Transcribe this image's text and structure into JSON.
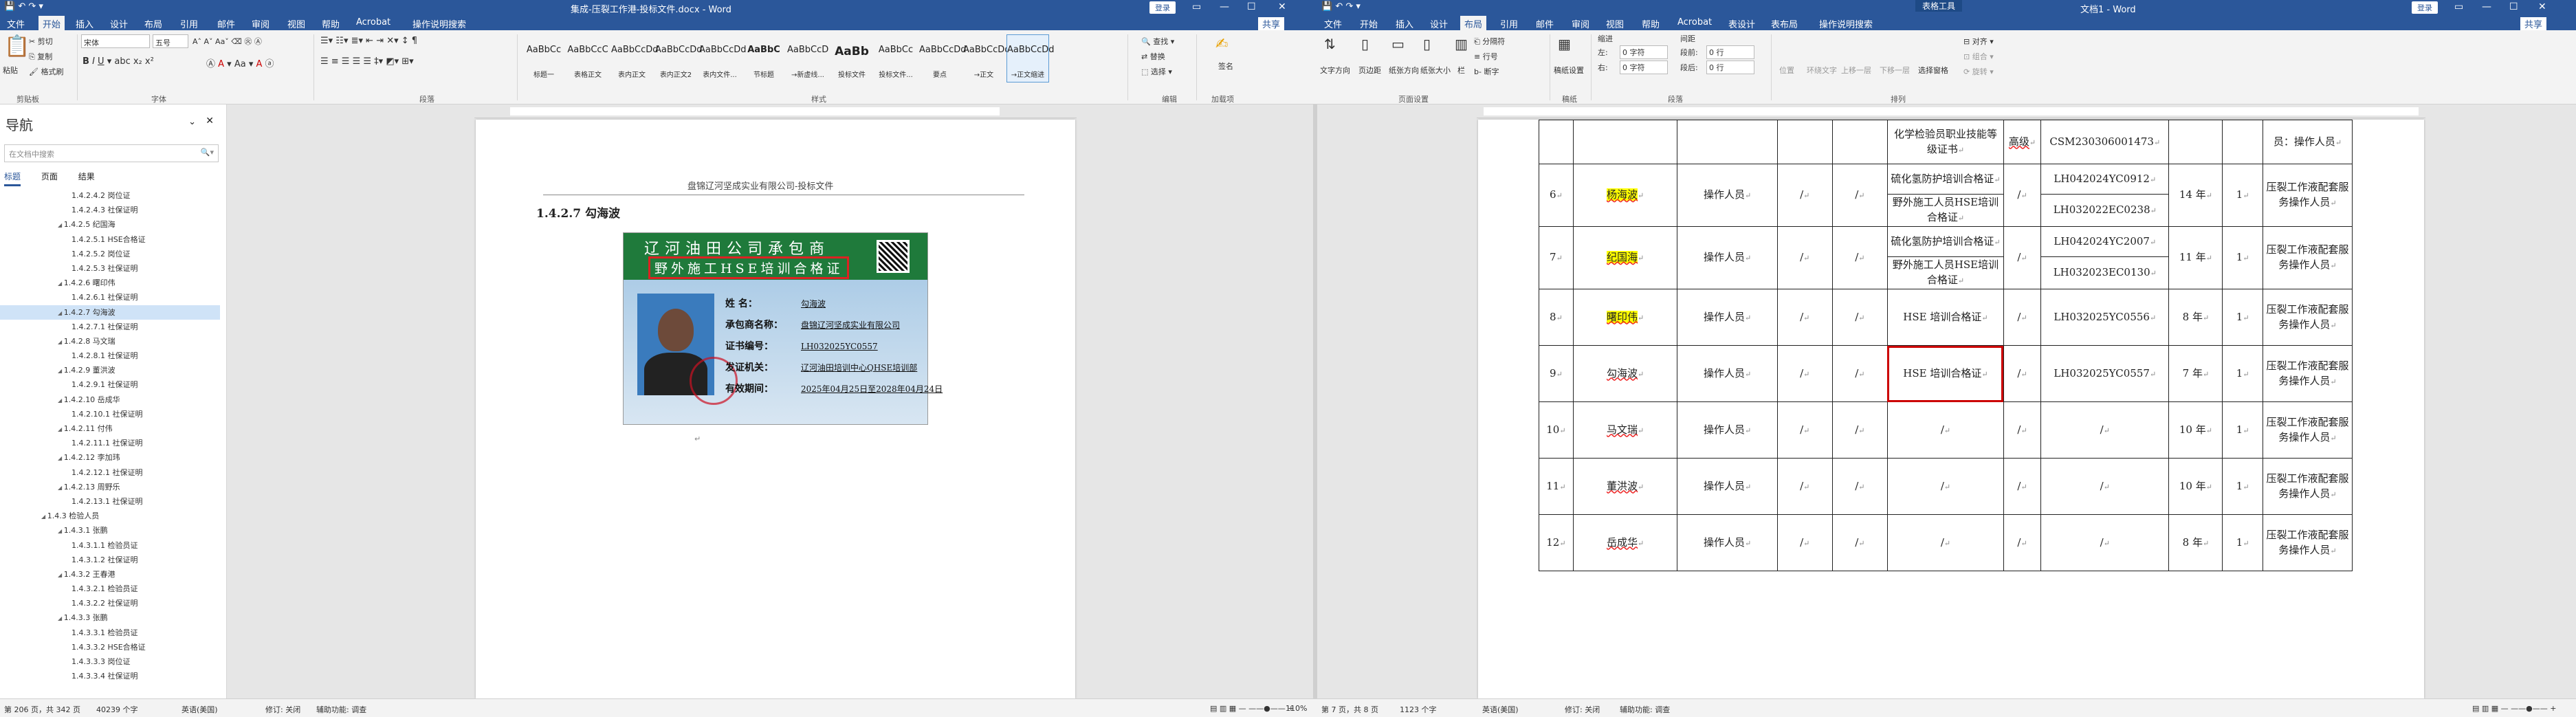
{
  "left": {
    "title": "集成-压裂工作港-投标文件.docx - Word",
    "login": "登录",
    "tabs": [
      "文件",
      "开始",
      "插入",
      "设计",
      "布局",
      "引用",
      "邮件",
      "审阅",
      "视图",
      "帮助",
      "Acrobat",
      "操作说明搜索"
    ],
    "active_tab": "开始",
    "share": "共享",
    "clipboard": {
      "paste": "粘贴",
      "cut": "剪切",
      "copy": "复制",
      "painter": "格式刷",
      "label": "剪贴板"
    },
    "font": {
      "name": "宋体",
      "size": "五号",
      "label": "字体"
    },
    "paragraph_label": "段落",
    "styles": [
      {
        "preview": "AaBbCc",
        "name": "标题一"
      },
      {
        "preview": "AaBbCcC",
        "name": "表格正文"
      },
      {
        "preview": "AaBbCcDd",
        "name": "表内正文"
      },
      {
        "preview": "AaBbCcDd",
        "name": "表内正文2"
      },
      {
        "preview": "AaBbCcDd",
        "name": "表内文件..."
      },
      {
        "preview": "AaBbC",
        "name": "节标题"
      },
      {
        "preview": "AaBbCcD",
        "name": "→新虚线..."
      },
      {
        "preview": "AaBb",
        "name": "投标文件"
      },
      {
        "preview": "AaBbCc",
        "name": "投标文件..."
      },
      {
        "preview": "AaBbCcDd",
        "name": "要点"
      },
      {
        "preview": "AaBbCcDd",
        "name": "→正文"
      },
      {
        "preview": "AaBbCcDd",
        "name": "→正文缩进"
      }
    ],
    "styles_label": "样式",
    "editing": {
      "find": "查找",
      "replace": "替换",
      "select": "选择",
      "label": "编辑"
    },
    "signature": {
      "label": "加载项",
      "btn": "签名"
    },
    "nav": {
      "title": "导航",
      "search_placeholder": "在文档中搜索",
      "tabs": [
        "标题",
        "页面",
        "结果"
      ],
      "items": [
        {
          "text": "1.4.2.4.2 岗位证",
          "level": 4
        },
        {
          "text": "1.4.2.4.3 社保证明",
          "level": 4
        },
        {
          "text": "1.4.2.5 纪国海",
          "level": 3
        },
        {
          "text": "1.4.2.5.1 HSE合格证",
          "level": 4
        },
        {
          "text": "1.4.2.5.2 岗位证",
          "level": 4
        },
        {
          "text": "1.4.2.5.3 社保证明",
          "level": 4
        },
        {
          "text": "1.4.2.6 曙印伟",
          "level": 3
        },
        {
          "text": "1.4.2.6.1 社保证明",
          "level": 4
        },
        {
          "text": "1.4.2.7 勾海波",
          "level": 3,
          "selected": true
        },
        {
          "text": "1.4.2.7.1 社保证明",
          "level": 4
        },
        {
          "text": "1.4.2.8 马文瑞",
          "level": 3
        },
        {
          "text": "1.4.2.8.1 社保证明",
          "level": 4
        },
        {
          "text": "1.4.2.9 董洪波",
          "level": 3
        },
        {
          "text": "1.4.2.9.1 社保证明",
          "level": 4
        },
        {
          "text": "1.4.2.10 岳成华",
          "level": 3
        },
        {
          "text": "1.4.2.10.1 社保证明",
          "level": 4
        },
        {
          "text": "1.4.2.11 付伟",
          "level": 3
        },
        {
          "text": "1.4.2.11.1 社保证明",
          "level": 4
        },
        {
          "text": "1.4.2.12 李加玮",
          "level": 3
        },
        {
          "text": "1.4.2.12.1 社保证明",
          "level": 4
        },
        {
          "text": "1.4.2.13 周野乐",
          "level": 3
        },
        {
          "text": "1.4.2.13.1 社保证明",
          "level": 4
        },
        {
          "text": "1.4.3 检验人员",
          "level": 2
        },
        {
          "text": "1.4.3.1 张鹏",
          "level": 3
        },
        {
          "text": "1.4.3.1.1 检验员证",
          "level": 4
        },
        {
          "text": "1.4.3.1.2 社保证明",
          "level": 4
        },
        {
          "text": "1.4.3.2 王春港",
          "level": 3
        },
        {
          "text": "1.4.3.2.1 检验员证",
          "level": 4
        },
        {
          "text": "1.4.3.2.2 社保证明",
          "level": 4
        },
        {
          "text": "1.4.3.3 张鹏",
          "level": 3
        },
        {
          "text": "1.4.3.3.1 检验员证",
          "level": 4
        },
        {
          "text": "1.4.3.3.2 HSE合格证",
          "level": 4
        },
        {
          "text": "1.4.3.3.3 岗位证",
          "level": 4
        },
        {
          "text": "1.4.3.3.4 社保证明",
          "level": 4
        }
      ]
    },
    "page": {
      "header": "盘锦辽河坚成实业有限公司-投标文件",
      "heading": "1.4.2.7 勾海波",
      "cert": {
        "line1": "辽河油田公司承包商",
        "line2": "野外施工HSE培训合格证",
        "fields": [
          {
            "k": "姓      名：",
            "v": "勾海波"
          },
          {
            "k": "承包商名称：",
            "v": "盘锦辽河坚成实业有限公司"
          },
          {
            "k": "证书编号：",
            "v": "LH032025YC0557"
          },
          {
            "k": "发证机关：",
            "v": "辽河油田培训中心QHSE培训部"
          },
          {
            "k": "有效期间：",
            "v": "2025年04月25日至2028年04月24日"
          }
        ]
      }
    },
    "status": {
      "page": "第 206 页，共 342 页",
      "words": "40239 个字",
      "lang": "英语(美国)",
      "track": "修订: 关闭",
      "access": "辅助功能: 调查",
      "zoom": "110%"
    }
  },
  "right": {
    "title": "文档1 - Word",
    "context_tools": "表格工具",
    "login": "登录",
    "share": "共享",
    "tabs": [
      "文件",
      "开始",
      "插入",
      "设计",
      "布局",
      "引用",
      "邮件",
      "审阅",
      "视图",
      "帮助",
      "Acrobat",
      "表设计",
      "表布局",
      "操作说明搜索"
    ],
    "active_tab": "布局",
    "ribbon": {
      "text_dir": "文字方向",
      "margins": "页边距",
      "orientation": "纸张方向",
      "size": "纸张大小",
      "columns": "栏",
      "breaks": "分隔符",
      "linenum": "行号",
      "hyphen": "断字",
      "page_setup": "页面设置",
      "draft": "稿纸设置",
      "draft_group": "稿纸",
      "indent": "缩进",
      "left": "左:",
      "right": "右:",
      "indent_l": "0 字符",
      "indent_r": "0 字符",
      "spacing": "间距",
      "before": "段前:",
      "after": "段后:",
      "sp_b": "0 行",
      "sp_a": "0 行",
      "para": "段落",
      "position": "位置",
      "wrap": "环绕文字",
      "forward": "上移一层",
      "backward": "下移一层",
      "pane": "选择窗格",
      "align": "对齐",
      "group": "组合",
      "rotate": "旋转",
      "arrange": "排列"
    },
    "table": {
      "top_row": [
        "化学检验员职业技能等级证书",
        "高级",
        "CSM230306001473",
        "员：操作人员"
      ],
      "rows": [
        {
          "no": "6",
          "name": "杨海波",
          "role": "操作人员",
          "c1": "/",
          "c2": "/",
          "certs": [
            "硫化氢防护培训合格证",
            "野外施工人员HSE培训合格证"
          ],
          "c3": "/",
          "ids": [
            "LH042024YC0912",
            "LH032022EC0238"
          ],
          "years": "14 年",
          "n": "1",
          "duty": "压裂工作液配套服务操作人员",
          "hl": true
        },
        {
          "no": "7",
          "name": "纪国海",
          "role": "操作人员",
          "c1": "/",
          "c2": "/",
          "certs": [
            "硫化氢防护培训合格证",
            "野外施工人员HSE培训合格证"
          ],
          "c3": "/",
          "ids": [
            "LH042024YC2007",
            "LH032023EC0130"
          ],
          "years": "11 年",
          "n": "1",
          "duty": "压裂工作液配套服务操作人员",
          "hl": true
        },
        {
          "no": "8",
          "name": "曙印伟",
          "role": "操作人员",
          "c1": "/",
          "c2": "/",
          "certs": [
            "HSE 培训合格证"
          ],
          "c3": "/",
          "ids": [
            "LH032025YC0556"
          ],
          "years": "8 年",
          "n": "1",
          "duty": "压裂工作液配套服务操作人员",
          "hl": true
        },
        {
          "no": "9",
          "name": "勾海波",
          "role": "操作人员",
          "c1": "/",
          "c2": "/",
          "certs": [
            "HSE 培训合格证"
          ],
          "c3": "/",
          "ids": [
            "LH032025YC0557"
          ],
          "years": "7 年",
          "n": "1",
          "duty": "压裂工作液配套服务操作人员",
          "box": true
        },
        {
          "no": "10",
          "name": "马文瑞",
          "role": "操作人员",
          "c1": "/",
          "c2": "/",
          "certs": [
            "/"
          ],
          "c3": "/",
          "ids": [
            "/"
          ],
          "years": "10 年",
          "n": "1",
          "duty": "压裂工作液配套服务操作人员"
        },
        {
          "no": "11",
          "name": "董洪波",
          "role": "操作人员",
          "c1": "/",
          "c2": "/",
          "certs": [
            "/"
          ],
          "c3": "/",
          "ids": [
            "/"
          ],
          "years": "10 年",
          "n": "1",
          "duty": "压裂工作液配套服务操作人员"
        },
        {
          "no": "12",
          "name": "岳成华",
          "role": "操作人员",
          "c1": "/",
          "c2": "/",
          "certs": [
            "/"
          ],
          "c3": "/",
          "ids": [
            "/"
          ],
          "years": "8 年",
          "n": "1",
          "duty": "压裂工作液配套服务操作人员"
        }
      ]
    },
    "status": {
      "page": "第 7 页，共 8 页",
      "words": "1123 个字",
      "lang": "英语(美国)",
      "track": "修订: 关闭",
      "access": "辅助功能: 调查"
    }
  }
}
